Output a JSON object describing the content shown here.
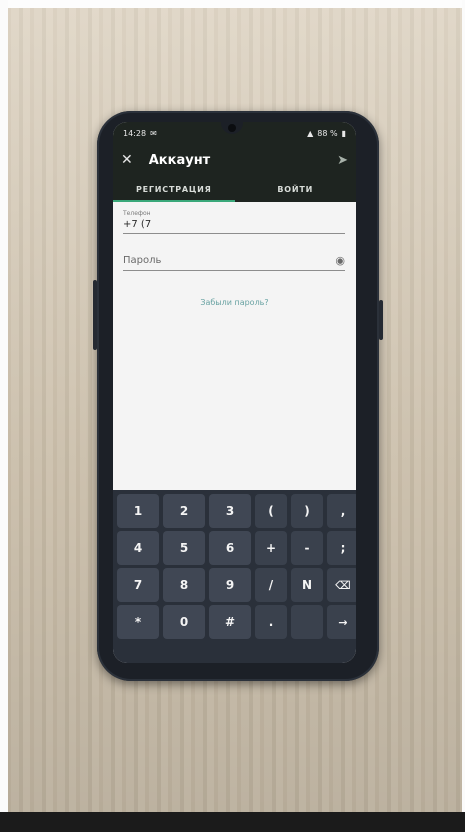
{
  "status_bar": {
    "time": "14:28",
    "battery": "88 %"
  },
  "app_bar": {
    "title": "Аккаунт"
  },
  "tabs": [
    {
      "label": "РЕГИСТРАЦИЯ",
      "active": true
    },
    {
      "label": "ВОЙТИ",
      "active": false
    }
  ],
  "form": {
    "phone_label": "Телефон",
    "phone_value": "+7 (7",
    "password_placeholder": "Пароль",
    "forgot_link": "Забыли пароль?"
  },
  "keyboard": {
    "rows": [
      [
        "1",
        "2",
        "3",
        "(",
        ")",
        ","
      ],
      [
        "4",
        "5",
        "6",
        "+",
        "-",
        ";"
      ],
      [
        "7",
        "8",
        "9",
        "/",
        "N",
        "⌫"
      ],
      [
        "*",
        "0",
        "#",
        ".",
        "",
        "→"
      ]
    ]
  },
  "colors": {
    "app_bar": "#1e2420",
    "tab_indicator": "#3aa87a",
    "link": "#6aa3a3",
    "keyboard_bg": "#2a303a",
    "key_bg": "#404754"
  },
  "icons": {
    "close": "close-icon",
    "send": "send-icon",
    "eye": "eye-icon",
    "backspace": "backspace-icon",
    "enter": "arrow-right-icon"
  }
}
